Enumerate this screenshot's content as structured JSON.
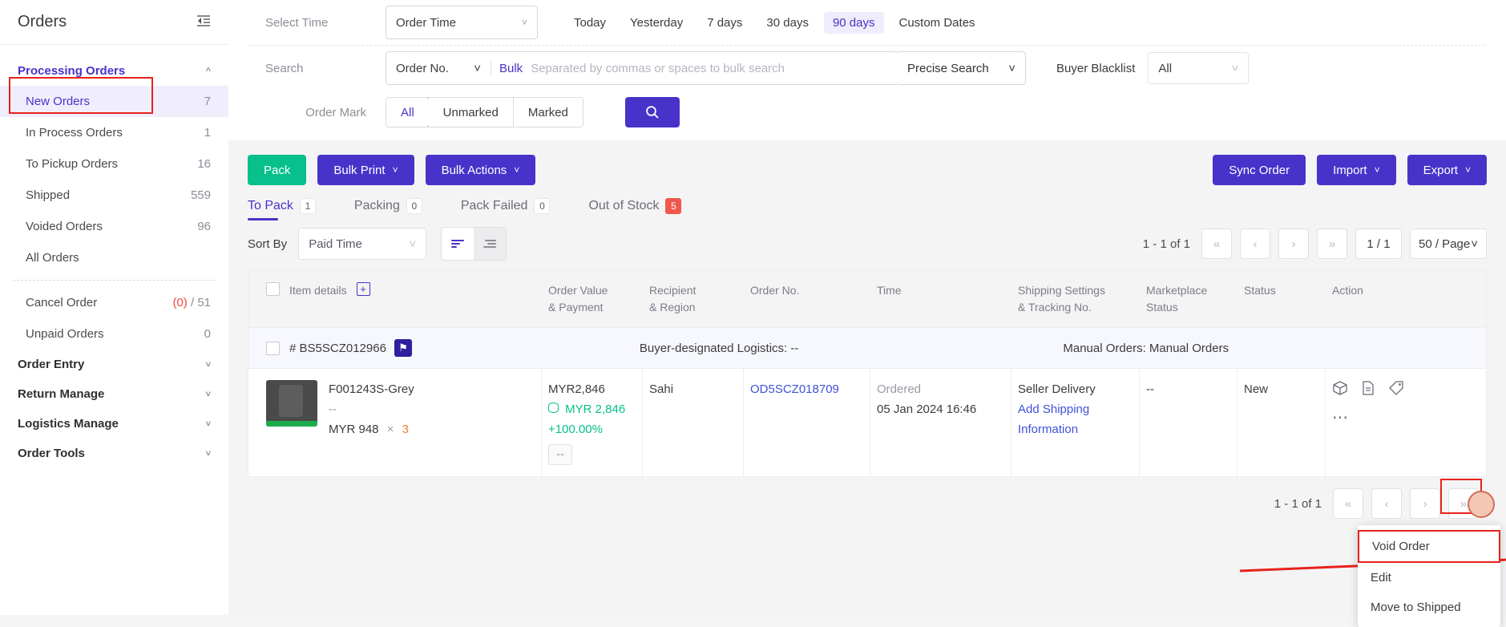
{
  "sidebar": {
    "title": "Orders",
    "collapse_icon": "collapse-icon",
    "groups": [
      {
        "label": "Processing Orders",
        "expanded": true,
        "chevron": "⌃"
      }
    ],
    "items": [
      {
        "label": "New Orders",
        "count": "7",
        "active": true
      },
      {
        "label": "In Process Orders",
        "count": "1"
      },
      {
        "label": "To Pickup Orders",
        "count": "16"
      },
      {
        "label": "Shipped",
        "count": "559"
      },
      {
        "label": "Voided Orders",
        "count": "96"
      },
      {
        "label": "All Orders",
        "count": ""
      }
    ],
    "items2": [
      {
        "label": "Cancel Order",
        "count_red": "(0)",
        "count_sep": " / ",
        "count": "51"
      },
      {
        "label": "Unpaid Orders",
        "count": "0"
      }
    ],
    "groups2": [
      {
        "label": "Order Entry"
      },
      {
        "label": "Return Manage"
      },
      {
        "label": "Logistics Manage"
      },
      {
        "label": "Order Tools"
      }
    ]
  },
  "filters": {
    "select_time_label": "Select Time",
    "time_type": "Order Time",
    "quick_ranges": [
      {
        "label": "Today",
        "active": false
      },
      {
        "label": "Yesterday",
        "active": false
      },
      {
        "label": "7 days",
        "active": false
      },
      {
        "label": "30 days",
        "active": false
      },
      {
        "label": "90 days",
        "active": true
      },
      {
        "label": "Custom Dates",
        "active": false
      }
    ],
    "search_label": "Search",
    "search_kind": "Order No.",
    "bulk_label": "Bulk",
    "search_placeholder": "Separated by commas or spaces to bulk search",
    "search_value": "",
    "precise_search": "Precise Search",
    "buyer_blacklist_label": "Buyer Blacklist",
    "buyer_blacklist_value": "All",
    "order_mark_label": "Order Mark",
    "order_mark_options": [
      {
        "label": "All",
        "active": true
      },
      {
        "label": "Unmarked",
        "active": false
      },
      {
        "label": "Marked",
        "active": false
      }
    ],
    "search_button_icon": "search-icon"
  },
  "toolbar": {
    "pack": "Pack",
    "bulk_print": "Bulk Print",
    "bulk_actions": "Bulk Actions",
    "sync_order": "Sync Order",
    "import": "Import",
    "export": "Export"
  },
  "tabs": [
    {
      "label": "To Pack",
      "count": "1",
      "active": true,
      "red": false
    },
    {
      "label": "Packing",
      "count": "0",
      "active": false,
      "red": false
    },
    {
      "label": "Pack Failed",
      "count": "0",
      "active": false,
      "red": false
    },
    {
      "label": "Out of Stock",
      "count": "5",
      "active": false,
      "red": true
    }
  ],
  "sort": {
    "label": "Sort By",
    "value": "Paid Time",
    "asc_icon": "sort-ascending-icon",
    "desc_icon": "sort-descending-icon"
  },
  "pager": {
    "range": "1 - 1 of 1",
    "first": "«",
    "prev": "‹",
    "next": "›",
    "last": "»",
    "current": "1 / 1",
    "page_size": "50 / Page"
  },
  "table": {
    "headers": [
      {
        "line1": "Item details",
        "line2": ""
      },
      {
        "line1": "Order Value",
        "line2": "& Payment"
      },
      {
        "line1": "Recipient",
        "line2": "& Region"
      },
      {
        "line1": "Order No.",
        "line2": ""
      },
      {
        "line1": "Time",
        "line2": ""
      },
      {
        "line1": "Shipping Settings",
        "line2": "& Tracking No."
      },
      {
        "line1": "Marketplace",
        "line2": "Status"
      },
      {
        "line1": "Status",
        "line2": ""
      },
      {
        "line1": "Action",
        "line2": ""
      }
    ],
    "order_bar": {
      "order_id": "# BS5SCZ012966",
      "flag_icon": "flag-icon",
      "logistics": "Buyer-designated Logistics: --",
      "manual": "Manual Orders: Manual Orders"
    },
    "row": {
      "sku": "F001243S-Grey",
      "variant": "--",
      "unit_price": "MYR 948",
      "times": "×",
      "qty": "3",
      "order_value": "MYR2,846",
      "paid_value": "MYR 2,846",
      "percent": "+100.00%",
      "dash_box": "--",
      "recipient": "Sahi",
      "order_no": "OD5SCZ018709",
      "time_label": "Ordered",
      "time_value": "05 Jan 2024 16:46",
      "shipping": "Seller Delivery",
      "shipping_link": "Add Shipping Information",
      "marketplace_status": "--",
      "status": "New",
      "action_icons": [
        "package-icon",
        "document-icon",
        "tag-icon",
        "more-icon"
      ]
    }
  },
  "context_menu": {
    "items": [
      {
        "label": "Void Order",
        "highlighted": true
      },
      {
        "label": "Edit",
        "highlighted": false
      },
      {
        "label": "Move to Shipped",
        "highlighted": false
      }
    ]
  },
  "colors": {
    "accent": "#4733c9",
    "green": "#07c08b",
    "red": "#e8231d",
    "link": "#3f51d8"
  }
}
